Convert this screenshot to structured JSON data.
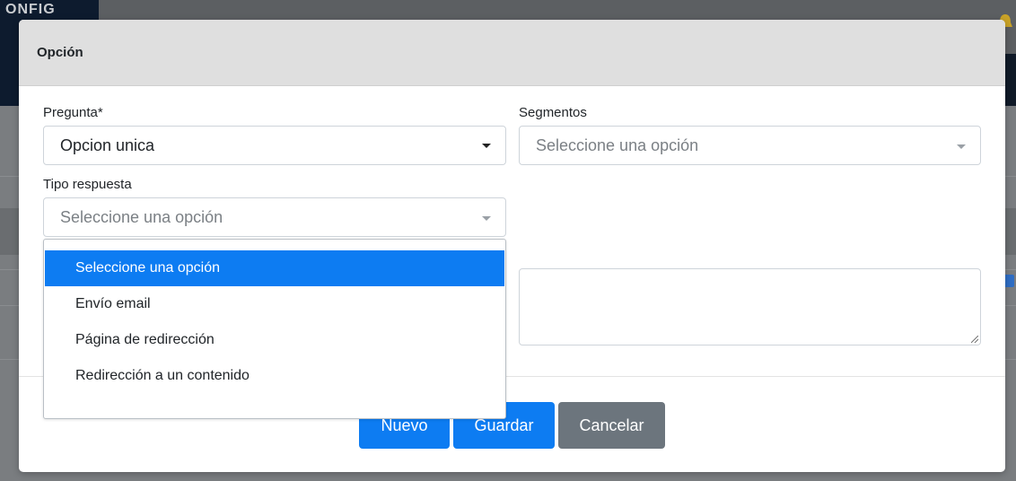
{
  "background": {
    "logo_fragment": "ONFIG"
  },
  "modal": {
    "title": "Opción",
    "fields": {
      "pregunta": {
        "label": "Pregunta*",
        "value": "Opcion unica"
      },
      "segmentos": {
        "label": "Segmentos",
        "placeholder": "Seleccione una opción"
      },
      "tipo_respuesta": {
        "label": "Tipo respuesta",
        "placeholder": "Seleccione una opción",
        "options": [
          "Seleccione una opción",
          "Envío email",
          "Página de redirección",
          "Redirección a un contenido"
        ],
        "highlighted_index": 0
      }
    },
    "buttons": {
      "nuevo": "Nuevo",
      "guardar": "Guardar",
      "cancelar": "Cancelar"
    }
  },
  "colors": {
    "primary": "#0d7cf2",
    "secondary": "#6c757d",
    "header_bg": "#dfdfdf"
  }
}
